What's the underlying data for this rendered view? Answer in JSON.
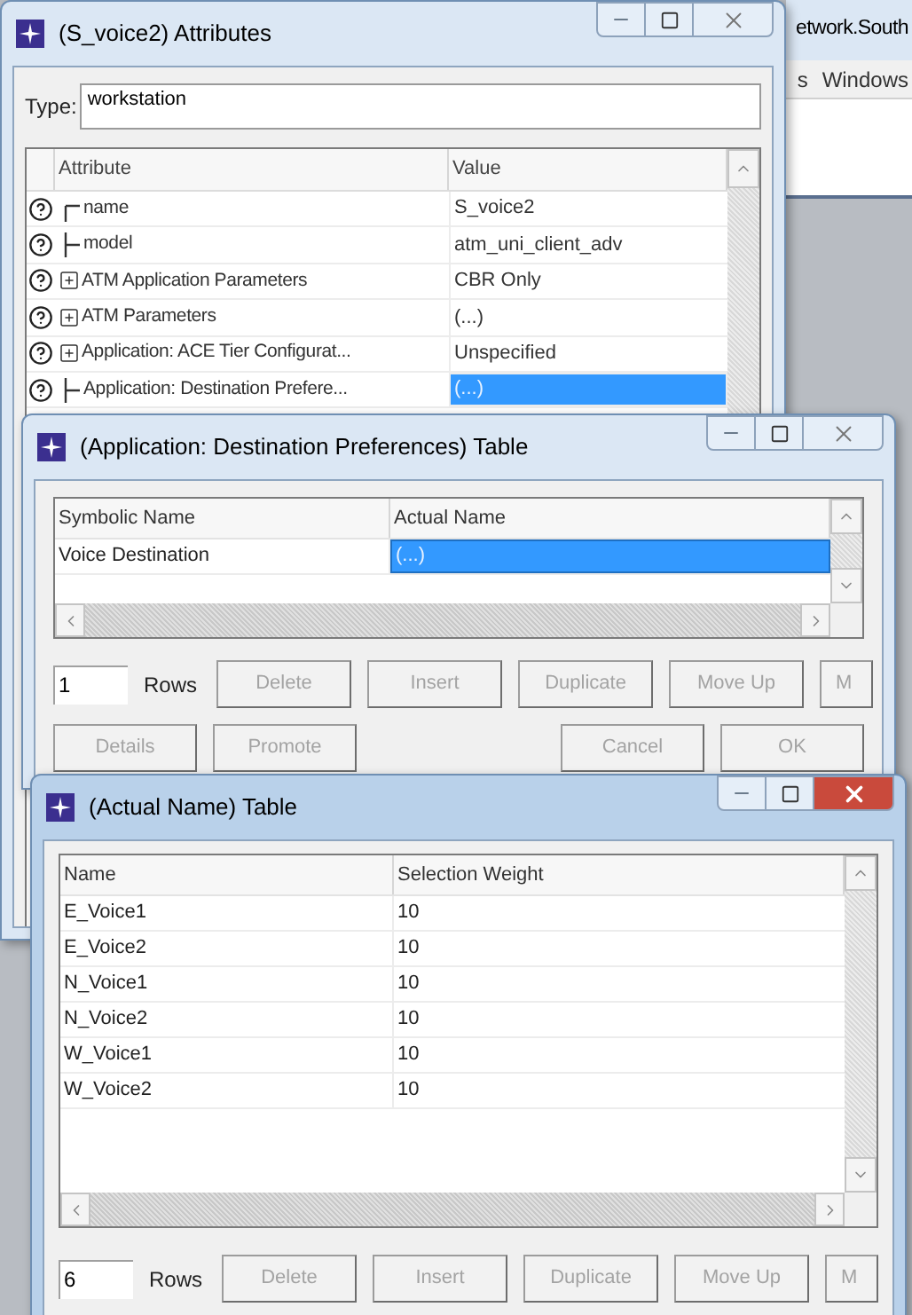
{
  "background_window": {
    "title": "etwork.South",
    "menu": [
      "s",
      "Windows"
    ]
  },
  "attributes_window": {
    "title": "(S_voice2) Attributes",
    "active": false,
    "type_label": "Type:",
    "type_value": "workstation",
    "columns": [
      "Attribute",
      "Value"
    ],
    "rows": [
      {
        "kind": "leaf",
        "attribute": "name",
        "value": "S_voice2",
        "selected": false
      },
      {
        "kind": "leaf",
        "attribute": "model",
        "value": "atm_uni_client_adv",
        "selected": false
      },
      {
        "kind": "group",
        "expanded": false,
        "attribute": "ATM Application Parameters",
        "value": "CBR Only",
        "selected": false
      },
      {
        "kind": "group",
        "expanded": false,
        "attribute": "ATM Parameters",
        "value": "(...)",
        "selected": false
      },
      {
        "kind": "group",
        "expanded": false,
        "attribute": "Application: ACE Tier Configurat...",
        "value": "Unspecified",
        "selected": false
      },
      {
        "kind": "leaf",
        "attribute": "Application: Destination Prefere...",
        "value": "(...)",
        "selected": true
      }
    ]
  },
  "destination_window": {
    "title": "(Application: Destination Preferences) Table",
    "active": false,
    "columns": [
      "Symbolic Name",
      "Actual Name"
    ],
    "rows": [
      {
        "name": "Voice Destination",
        "value": "(...)",
        "selected": true
      }
    ],
    "row_count": "1",
    "rows_label": "Rows",
    "buttons": [
      {
        "label": "Delete",
        "disabled": true
      },
      {
        "label": "Insert",
        "disabled": true
      },
      {
        "label": "Duplicate",
        "disabled": true
      },
      {
        "label": "Move Up",
        "disabled": true
      },
      {
        "label": "M",
        "disabled": true
      }
    ],
    "bottom_buttons": [
      {
        "label": "Details",
        "disabled": true
      },
      {
        "label": "Promote",
        "disabled": true
      },
      {
        "label": "Cancel",
        "disabled": true
      },
      {
        "label": "OK",
        "disabled": true
      }
    ]
  },
  "actual_name_window": {
    "title": "(Actual Name) Table",
    "active": true,
    "columns": [
      "Name",
      "Selection Weight"
    ],
    "rows": [
      {
        "name": "E_Voice1",
        "value": "10",
        "selected": false
      },
      {
        "name": "E_Voice2",
        "value": "10",
        "selected": false
      },
      {
        "name": "N_Voice1",
        "value": "10",
        "selected": false
      },
      {
        "name": "N_Voice2",
        "value": "10",
        "selected": false
      },
      {
        "name": "W_Voice1",
        "value": "10",
        "selected": false
      },
      {
        "name": "W_Voice2",
        "value": "10",
        "selected": false
      }
    ],
    "row_count": "6",
    "rows_label": "Rows",
    "buttons": [
      {
        "label": "Delete",
        "disabled": true
      },
      {
        "label": "Insert",
        "disabled": true
      },
      {
        "label": "Duplicate",
        "disabled": true
      },
      {
        "label": "Move Up",
        "disabled": true
      },
      {
        "label": "M",
        "disabled": true
      }
    ]
  }
}
